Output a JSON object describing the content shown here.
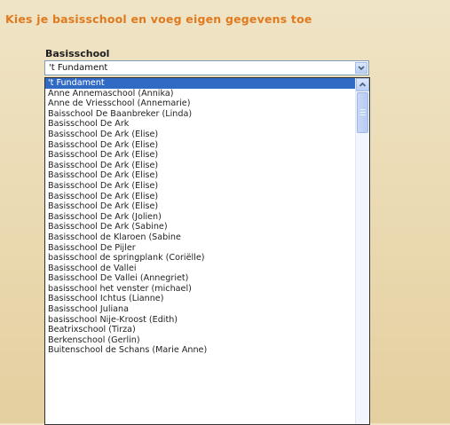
{
  "heading": {
    "text": "Kies je basisschool en voeg eigen gegevens toe",
    "color": "#e07a1f"
  },
  "field": {
    "label": "Basisschool",
    "selected_value": "'t Fundament"
  },
  "dropdown": {
    "options": [
      "'t Fundament",
      "Anne Annemaschool (Annika)",
      "Anne de Vriesschool (Annemarie)",
      "Baisschool De Baanbreker (Linda)",
      "Basisschool De Ark",
      "Basisschool De Ark (Elise)",
      "Basisschool De Ark (Elise)",
      "Basisschool De Ark (Elise)",
      "Basisschool De Ark (Elise)",
      "Basisschool De Ark (Elise)",
      "Basisschool De Ark (Elise)",
      "Basisschool De Ark (Elise)",
      "Basisschool De Ark (Elise)",
      "Basisschool De Ark (Jolien)",
      "Basisschool De Ark (Sabine)",
      "Basisschool de Klaroen (Sabine",
      "Basisschool De Pijler",
      "basisschool de springplank (Coriëlle)",
      "Basisschool de Vallei",
      "Basisschool De Vallei (Annegriet)",
      "basisschool het venster (michael)",
      "Basisschool Ichtus (Lianne)",
      "Basisschool Juliana",
      "basisschool Nije-Kroost (Edith)",
      "Beatrixschool (Tirza)",
      "Berkenschool (Gerlin)",
      "Buitenschool de Schans (Marie Anne)"
    ],
    "selected_index": 0
  },
  "colors": {
    "selection": "#316ac5",
    "scroll_button": "#b9cff5"
  },
  "icons": {
    "select_arrow": "chevron-down-icon",
    "scroll_up": "chevron-up-icon"
  }
}
